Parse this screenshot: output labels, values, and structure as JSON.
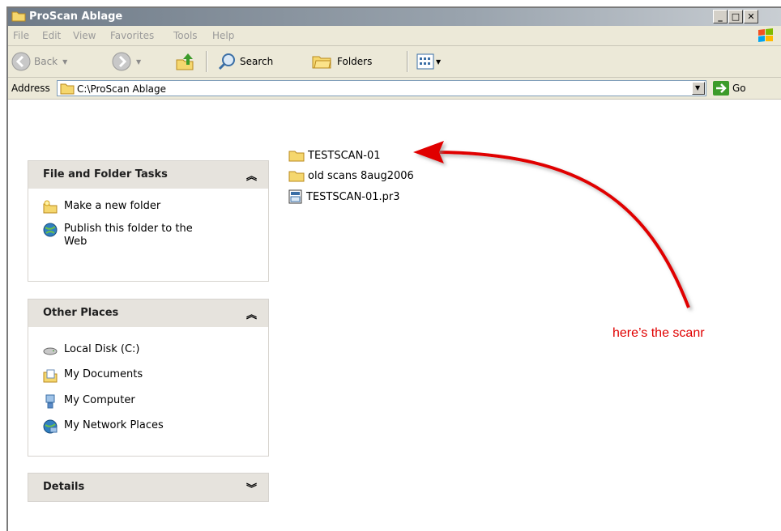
{
  "window": {
    "title": "ProScan Ablage"
  },
  "menu": [
    "File",
    "Edit",
    "View",
    "Favorites",
    "Tools",
    "Help"
  ],
  "toolbar": {
    "back": "Back",
    "search": "Search",
    "folders": "Folders"
  },
  "address": {
    "label": "Address",
    "path": "C:\\ProScan Ablage",
    "go": "Go"
  },
  "panels": {
    "file_tasks": {
      "title": "File and Folder Tasks",
      "items": [
        "Make a new folder",
        "Publish this folder to the Web"
      ]
    },
    "other_places": {
      "title": "Other Places",
      "items": [
        "Local Disk (C:)",
        "My Documents",
        "My Computer",
        "My Network Places"
      ]
    },
    "details": {
      "title": "Details"
    }
  },
  "files": [
    {
      "name": "TESTSCAN-01",
      "type": "folder"
    },
    {
      "name": "old scans 8aug2006",
      "type": "folder"
    },
    {
      "name": "TESTSCAN-01.pr3",
      "type": "file"
    }
  ],
  "annotation": {
    "text": "here’s the scanr"
  }
}
